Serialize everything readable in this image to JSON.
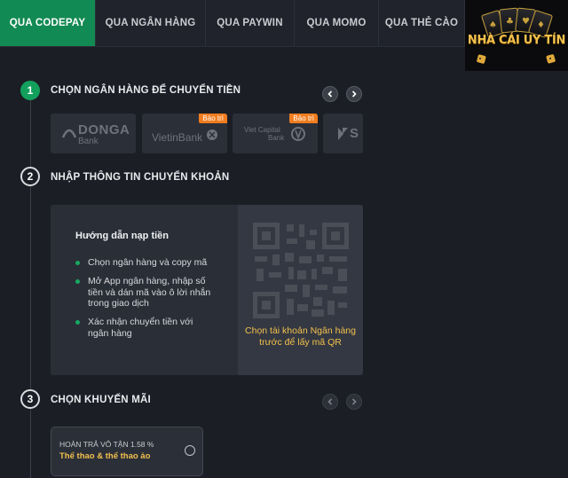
{
  "tabs": [
    {
      "label": "QUA CODEPAY",
      "active": true
    },
    {
      "label": "QUA NGÂN HÀNG",
      "active": false
    },
    {
      "label": "QUA PAYWIN",
      "active": false
    },
    {
      "label": "QUA MOMO",
      "active": false
    },
    {
      "label": "QUA THẺ CÀO",
      "active": false
    }
  ],
  "logo": {
    "text": "NHÀ CÁI UY TÍN"
  },
  "steps": [
    {
      "number": "1",
      "title": "CHỌN NGÂN HÀNG ĐỂ CHUYỂN TIỀN"
    },
    {
      "number": "2",
      "title": "NHẬP THÔNG TIN CHUYỂN KHOẢN"
    },
    {
      "number": "3",
      "title": "CHỌN KHUYẾN MÃI"
    }
  ],
  "banks": [
    {
      "name": "DONGA",
      "sub": "Bank",
      "badge": ""
    },
    {
      "name": "VietinBank",
      "sub": "",
      "badge": "Bảo trì"
    },
    {
      "name": "Viet Capital",
      "sub": "Bank",
      "badge": "Bảo trì"
    },
    {
      "name": "S",
      "sub": "",
      "badge": ""
    }
  ],
  "guide": {
    "title": "Hướng dẫn nạp tiền",
    "items": [
      "Chọn ngân hàng và copy mã",
      "Mở App ngân hàng, nhập số tiền và dán mã vào ô lời nhắn trong giao dịch",
      "Xác nhận chuyển tiền với ngân hàng"
    ],
    "qr_note": "Chọn tài khoản Ngân hàng trước để lấy mã QR"
  },
  "promo": {
    "title": "HOÀN TRẢ VÔ TẬN 1.58 %",
    "subtitle": "Thể thao & thể thao ảo"
  },
  "colors": {
    "accent": "#128a53",
    "highlight": "#f2c14e",
    "badge": "#f07d1f"
  },
  "icons": {
    "prev": "chevron-left-icon",
    "next": "chevron-right-icon"
  }
}
